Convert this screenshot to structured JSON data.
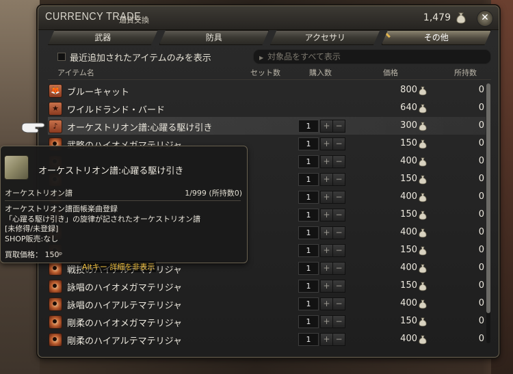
{
  "window": {
    "title_en": "CURRENCY TRADE",
    "title_jp": "通貨交換",
    "gil": "1,479",
    "close_glyph": "✕"
  },
  "tabs": [
    {
      "label": "武器",
      "active": false
    },
    {
      "label": "防具",
      "active": false
    },
    {
      "label": "アクセサリ",
      "active": false
    },
    {
      "label": "その他",
      "active": true
    }
  ],
  "filter": {
    "recent_only_label": "最近追加されたアイテムのみを表示",
    "show_all_label": "対象品をすべて表示"
  },
  "columns": {
    "item_name": "アイテム名",
    "set_count": "セット数",
    "purchase_count": "購入数",
    "price": "価格",
    "owned": "所持数"
  },
  "rows": [
    {
      "icon": "fox-icon",
      "glyph": "🦊",
      "name": "ブルーキャット",
      "qty": "",
      "price": "800",
      "owned": "0"
    },
    {
      "icon": "star-icon",
      "glyph": "★",
      "name": "ワイルドランド・バード",
      "qty": "",
      "price": "640",
      "owned": "0"
    },
    {
      "icon": "music-note-icon",
      "glyph": "♪",
      "name": "オーケストリオン譜:心躍る駆け引き",
      "qty": "1",
      "price": "300",
      "owned": "0"
    },
    {
      "icon": "materia-icon",
      "glyph": "",
      "name": "武略のハイオメガマテリジャ",
      "qty": "1",
      "price": "150",
      "owned": "0"
    },
    {
      "icon": "materia-icon",
      "glyph": "",
      "name": "",
      "qty": "1",
      "price": "400",
      "owned": "0"
    },
    {
      "icon": "materia-icon",
      "glyph": "",
      "name": "",
      "qty": "1",
      "price": "150",
      "owned": "0"
    },
    {
      "icon": "materia-icon",
      "glyph": "",
      "name": "",
      "qty": "1",
      "price": "400",
      "owned": "0"
    },
    {
      "icon": "materia-icon",
      "glyph": "",
      "name": "",
      "qty": "1",
      "price": "150",
      "owned": "0"
    },
    {
      "icon": "materia-icon",
      "glyph": "",
      "name": "",
      "qty": "1",
      "price": "400",
      "owned": "0"
    },
    {
      "icon": "materia-icon",
      "glyph": "",
      "name": "",
      "qty": "1",
      "price": "150",
      "owned": "0"
    },
    {
      "icon": "materia-icon",
      "glyph": "",
      "name": "戦技のハイアルテマテリジャ",
      "qty": "1",
      "price": "400",
      "owned": "0"
    },
    {
      "icon": "materia-icon",
      "glyph": "",
      "name": "詠唱のハイオメガマテリジャ",
      "qty": "1",
      "price": "150",
      "owned": "0"
    },
    {
      "icon": "materia-icon",
      "glyph": "",
      "name": "詠唱のハイアルテマテリジャ",
      "qty": "1",
      "price": "400",
      "owned": "0"
    },
    {
      "icon": "materia-icon",
      "glyph": "",
      "name": "剛柔のハイオメガマテリジャ",
      "qty": "1",
      "price": "150",
      "owned": "0"
    },
    {
      "icon": "materia-icon",
      "glyph": "",
      "name": "剛柔のハイアルテマテリジャ",
      "qty": "1",
      "price": "400",
      "owned": "0"
    }
  ],
  "tooltip": {
    "title": "オーケストリオン譜:心躍る駆け引き",
    "category": "オーケストリオン譜",
    "count": "1/999 (所持数0)",
    "desc_lines": [
      "オーケストリオン譜面帳楽曲登録",
      "「心躍る駆け引き」の旋律が記されたオーケストリオン譜",
      "[未修得/未登録]",
      "SHOP販売:なし"
    ],
    "sell_price": "買取価格： 150ᵖ",
    "hint": "Altキー 詳細を非表示"
  },
  "scroll_position": 0.0,
  "colors": {
    "accent": "#e3b650",
    "text": "#ece8de",
    "panel": "#1e1e1e"
  }
}
